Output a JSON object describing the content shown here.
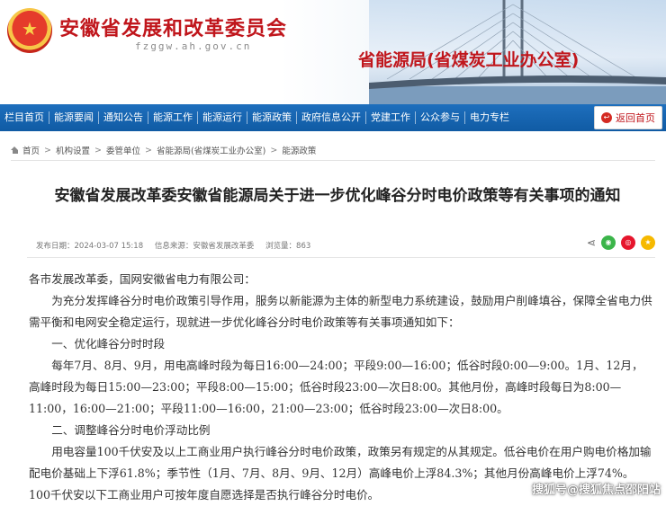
{
  "header": {
    "org_title": "安徽省发展和改革委员会",
    "domain": "fzggw.ah.gov.cn",
    "bureau_title": "省能源局(省煤炭工业办公室)"
  },
  "nav": {
    "items": [
      "栏目首页",
      "能源要闻",
      "通知公告",
      "能源工作",
      "能源运行",
      "能源政策",
      "政府信息公开",
      "党建工作",
      "公众参与",
      "电力专栏"
    ],
    "home_button": "返回首页"
  },
  "breadcrumb": [
    "首页",
    "机构设置",
    "委管单位",
    "省能源局(省煤炭工业办公室)",
    "能源政策"
  ],
  "article": {
    "title": "安徽省发展改革委安徽省能源局关于进一步优化峰谷分时电价政策等有关事项的通知",
    "publish_date": "发布日期：2024-03-07 15:18",
    "source": "信息来源：安徽省发展改革委",
    "views": "浏览量：863",
    "paragraphs": [
      "各市发展改革委，国网安徽省电力有限公司：",
      "为充分发挥峰谷分时电价政策引导作用，服务以新能源为主体的新型电力系统建设，鼓励用户削峰填谷，保障全省电力供需平衡和电网安全稳定运行，现就进一步优化峰谷分时电价政策等有关事项通知如下：",
      "一、优化峰谷分时时段",
      "每年7月、8月、9月，用电高峰时段为每日16:00—24:00；平段9:00—16:00；低谷时段0:00—9:00。1月、12月，高峰时段为每日15:00—23:00；平段8:00—15:00；低谷时段23:00—次日8:00。其他月份，高峰时段每日为8:00—11:00，16:00—21:00；平段11:00—16:00，21:00—23:00；低谷时段23:00—次日8:00。",
      "二、调整峰谷分时电价浮动比例",
      "用电容量100千伏安及以上工商业用户执行峰谷分时电价政策，政策另有规定的从其规定。低谷电价在用户购电价格加输配电价基础上下浮61.8%；季节性（1月、7月、8月、9月、12月）高峰电价上浮84.3%；其他月份高峰电价上浮74%。100千伏安以下工商业用户可按年度自愿选择是否执行峰谷分时电价。"
    ]
  },
  "watermark": "搜狐号@搜狐焦点邵阳站",
  "colors": {
    "brand_red": "#c0161c",
    "nav_blue": "#1565b0"
  },
  "icons": [
    "emblem",
    "home-icon",
    "share-icon",
    "wechat-icon",
    "weibo-icon",
    "qzone-icon",
    "return-icon"
  ]
}
